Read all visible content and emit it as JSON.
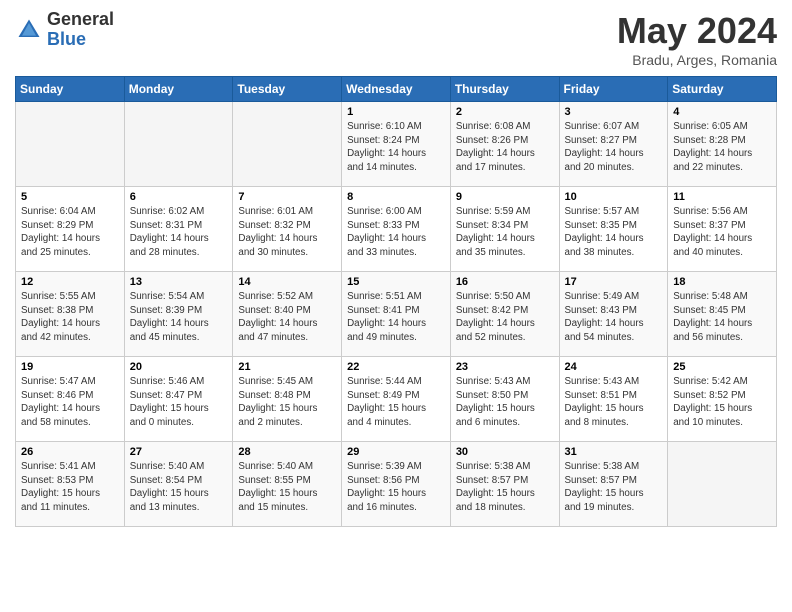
{
  "header": {
    "logo_general": "General",
    "logo_blue": "Blue",
    "month_title": "May 2024",
    "location": "Bradu, Arges, Romania"
  },
  "days_of_week": [
    "Sunday",
    "Monday",
    "Tuesday",
    "Wednesday",
    "Thursday",
    "Friday",
    "Saturday"
  ],
  "weeks": [
    [
      {
        "day": "",
        "info": ""
      },
      {
        "day": "",
        "info": ""
      },
      {
        "day": "",
        "info": ""
      },
      {
        "day": "1",
        "info": "Sunrise: 6:10 AM\nSunset: 8:24 PM\nDaylight: 14 hours and 14 minutes."
      },
      {
        "day": "2",
        "info": "Sunrise: 6:08 AM\nSunset: 8:26 PM\nDaylight: 14 hours and 17 minutes."
      },
      {
        "day": "3",
        "info": "Sunrise: 6:07 AM\nSunset: 8:27 PM\nDaylight: 14 hours and 20 minutes."
      },
      {
        "day": "4",
        "info": "Sunrise: 6:05 AM\nSunset: 8:28 PM\nDaylight: 14 hours and 22 minutes."
      }
    ],
    [
      {
        "day": "5",
        "info": "Sunrise: 6:04 AM\nSunset: 8:29 PM\nDaylight: 14 hours and 25 minutes."
      },
      {
        "day": "6",
        "info": "Sunrise: 6:02 AM\nSunset: 8:31 PM\nDaylight: 14 hours and 28 minutes."
      },
      {
        "day": "7",
        "info": "Sunrise: 6:01 AM\nSunset: 8:32 PM\nDaylight: 14 hours and 30 minutes."
      },
      {
        "day": "8",
        "info": "Sunrise: 6:00 AM\nSunset: 8:33 PM\nDaylight: 14 hours and 33 minutes."
      },
      {
        "day": "9",
        "info": "Sunrise: 5:59 AM\nSunset: 8:34 PM\nDaylight: 14 hours and 35 minutes."
      },
      {
        "day": "10",
        "info": "Sunrise: 5:57 AM\nSunset: 8:35 PM\nDaylight: 14 hours and 38 minutes."
      },
      {
        "day": "11",
        "info": "Sunrise: 5:56 AM\nSunset: 8:37 PM\nDaylight: 14 hours and 40 minutes."
      }
    ],
    [
      {
        "day": "12",
        "info": "Sunrise: 5:55 AM\nSunset: 8:38 PM\nDaylight: 14 hours and 42 minutes."
      },
      {
        "day": "13",
        "info": "Sunrise: 5:54 AM\nSunset: 8:39 PM\nDaylight: 14 hours and 45 minutes."
      },
      {
        "day": "14",
        "info": "Sunrise: 5:52 AM\nSunset: 8:40 PM\nDaylight: 14 hours and 47 minutes."
      },
      {
        "day": "15",
        "info": "Sunrise: 5:51 AM\nSunset: 8:41 PM\nDaylight: 14 hours and 49 minutes."
      },
      {
        "day": "16",
        "info": "Sunrise: 5:50 AM\nSunset: 8:42 PM\nDaylight: 14 hours and 52 minutes."
      },
      {
        "day": "17",
        "info": "Sunrise: 5:49 AM\nSunset: 8:43 PM\nDaylight: 14 hours and 54 minutes."
      },
      {
        "day": "18",
        "info": "Sunrise: 5:48 AM\nSunset: 8:45 PM\nDaylight: 14 hours and 56 minutes."
      }
    ],
    [
      {
        "day": "19",
        "info": "Sunrise: 5:47 AM\nSunset: 8:46 PM\nDaylight: 14 hours and 58 minutes."
      },
      {
        "day": "20",
        "info": "Sunrise: 5:46 AM\nSunset: 8:47 PM\nDaylight: 15 hours and 0 minutes."
      },
      {
        "day": "21",
        "info": "Sunrise: 5:45 AM\nSunset: 8:48 PM\nDaylight: 15 hours and 2 minutes."
      },
      {
        "day": "22",
        "info": "Sunrise: 5:44 AM\nSunset: 8:49 PM\nDaylight: 15 hours and 4 minutes."
      },
      {
        "day": "23",
        "info": "Sunrise: 5:43 AM\nSunset: 8:50 PM\nDaylight: 15 hours and 6 minutes."
      },
      {
        "day": "24",
        "info": "Sunrise: 5:43 AM\nSunset: 8:51 PM\nDaylight: 15 hours and 8 minutes."
      },
      {
        "day": "25",
        "info": "Sunrise: 5:42 AM\nSunset: 8:52 PM\nDaylight: 15 hours and 10 minutes."
      }
    ],
    [
      {
        "day": "26",
        "info": "Sunrise: 5:41 AM\nSunset: 8:53 PM\nDaylight: 15 hours and 11 minutes."
      },
      {
        "day": "27",
        "info": "Sunrise: 5:40 AM\nSunset: 8:54 PM\nDaylight: 15 hours and 13 minutes."
      },
      {
        "day": "28",
        "info": "Sunrise: 5:40 AM\nSunset: 8:55 PM\nDaylight: 15 hours and 15 minutes."
      },
      {
        "day": "29",
        "info": "Sunrise: 5:39 AM\nSunset: 8:56 PM\nDaylight: 15 hours and 16 minutes."
      },
      {
        "day": "30",
        "info": "Sunrise: 5:38 AM\nSunset: 8:57 PM\nDaylight: 15 hours and 18 minutes."
      },
      {
        "day": "31",
        "info": "Sunrise: 5:38 AM\nSunset: 8:57 PM\nDaylight: 15 hours and 19 minutes."
      },
      {
        "day": "",
        "info": ""
      }
    ]
  ]
}
